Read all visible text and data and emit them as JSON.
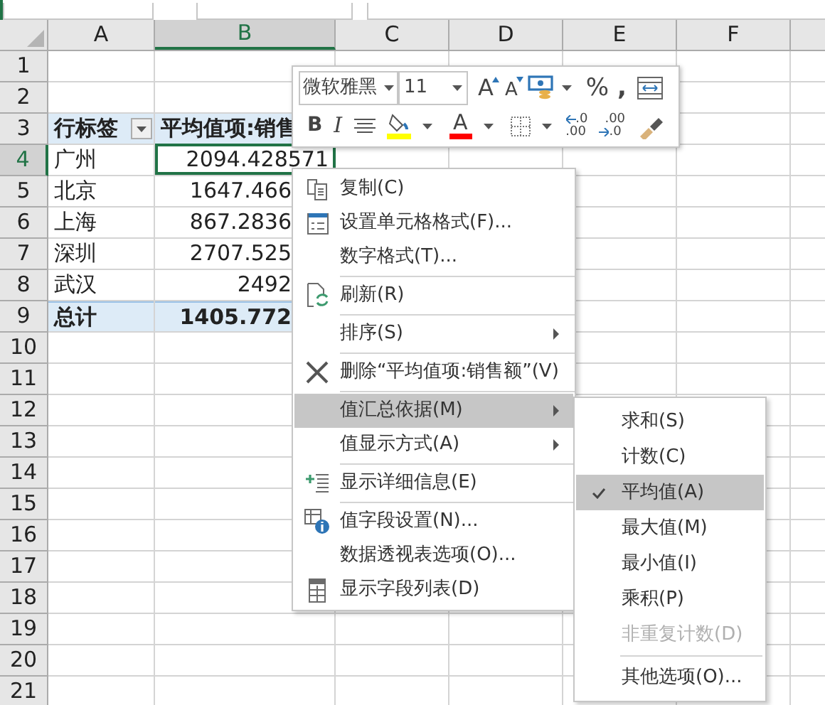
{
  "sheet": {
    "columns": [
      {
        "label": "A",
        "selected": false
      },
      {
        "label": "B",
        "selected": true
      },
      {
        "label": "C",
        "selected": false
      },
      {
        "label": "D",
        "selected": false
      },
      {
        "label": "E",
        "selected": false
      },
      {
        "label": "F",
        "selected": false
      }
    ],
    "rows": [
      {
        "label": "1",
        "selected": false,
        "kind": "blank",
        "cells": []
      },
      {
        "label": "2",
        "selected": false,
        "kind": "blank",
        "cells": []
      },
      {
        "label": "3",
        "selected": false,
        "kind": "pivot_header",
        "cells": [
          "行标签",
          "平均值项:销售"
        ]
      },
      {
        "label": "4",
        "selected": true,
        "kind": "pivot_row",
        "cells": [
          "广州",
          "2094.428571"
        ]
      },
      {
        "label": "5",
        "selected": false,
        "kind": "pivot_row",
        "cells": [
          "北京",
          "1647.466"
        ]
      },
      {
        "label": "6",
        "selected": false,
        "kind": "pivot_row",
        "cells": [
          "上海",
          "867.2836"
        ]
      },
      {
        "label": "7",
        "selected": false,
        "kind": "pivot_row",
        "cells": [
          "深圳",
          "2707.525"
        ]
      },
      {
        "label": "8",
        "selected": false,
        "kind": "pivot_row",
        "cells": [
          "武汉",
          "2492"
        ]
      },
      {
        "label": "9",
        "selected": false,
        "kind": "pivot_total",
        "cells": [
          "总计",
          "1405.772"
        ]
      },
      {
        "label": "10",
        "selected": false,
        "kind": "blank",
        "cells": []
      },
      {
        "label": "11",
        "selected": false,
        "kind": "blank",
        "cells": []
      },
      {
        "label": "12",
        "selected": false,
        "kind": "blank",
        "cells": []
      },
      {
        "label": "13",
        "selected": false,
        "kind": "blank",
        "cells": []
      },
      {
        "label": "14",
        "selected": false,
        "kind": "blank",
        "cells": []
      },
      {
        "label": "15",
        "selected": false,
        "kind": "blank",
        "cells": []
      },
      {
        "label": "16",
        "selected": false,
        "kind": "blank",
        "cells": []
      },
      {
        "label": "17",
        "selected": false,
        "kind": "blank",
        "cells": []
      },
      {
        "label": "18",
        "selected": false,
        "kind": "blank",
        "cells": []
      },
      {
        "label": "19",
        "selected": false,
        "kind": "blank",
        "cells": []
      },
      {
        "label": "20",
        "selected": false,
        "kind": "blank",
        "cells": []
      },
      {
        "label": "21",
        "selected": false,
        "kind": "blank",
        "cells": []
      }
    ]
  },
  "mini_toolbar": {
    "font": "微软雅黑",
    "size": "11",
    "grow_letter": "A",
    "shrink_letter": "A",
    "percent": "%",
    "comma": ",",
    "bold": "B",
    "italic": "I",
    "font_letter": "A",
    "increase_decimal": [
      ".0",
      ".00"
    ],
    "decrease_decimal": [
      ".00",
      ".0"
    ]
  },
  "context_menu": {
    "items": [
      {
        "kind": "item",
        "label": "复制(C)",
        "submenu": false,
        "selected": false
      },
      {
        "kind": "item",
        "label": "设置单元格格式(F)...",
        "submenu": false,
        "selected": false
      },
      {
        "kind": "item",
        "label": "数字格式(T)...",
        "submenu": false,
        "selected": false
      },
      {
        "kind": "separator"
      },
      {
        "kind": "item",
        "label": "刷新(R)",
        "submenu": false,
        "selected": false
      },
      {
        "kind": "separator"
      },
      {
        "kind": "item",
        "label": "排序(S)",
        "submenu": true,
        "selected": false
      },
      {
        "kind": "separator"
      },
      {
        "kind": "item",
        "label": "删除“平均值项:销售额”(V)",
        "submenu": false,
        "selected": false
      },
      {
        "kind": "separator"
      },
      {
        "kind": "item",
        "label": "值汇总依据(M)",
        "submenu": true,
        "selected": true
      },
      {
        "kind": "item",
        "label": "值显示方式(A)",
        "submenu": true,
        "selected": false
      },
      {
        "kind": "separator"
      },
      {
        "kind": "item",
        "label": "显示详细信息(E)",
        "submenu": false,
        "selected": false
      },
      {
        "kind": "separator"
      },
      {
        "kind": "item",
        "label": "值字段设置(N)...",
        "submenu": false,
        "selected": false
      },
      {
        "kind": "item",
        "label": "数据透视表选项(O)...",
        "submenu": false,
        "selected": false
      },
      {
        "kind": "item",
        "label": "显示字段列表(D)",
        "submenu": false,
        "selected": false
      }
    ]
  },
  "submenu": {
    "items": [
      {
        "kind": "item",
        "label": "求和(S)",
        "checked": false,
        "selected": false,
        "disabled": false
      },
      {
        "kind": "item",
        "label": "计数(C)",
        "checked": false,
        "selected": false,
        "disabled": false
      },
      {
        "kind": "item",
        "label": "平均值(A)",
        "checked": true,
        "selected": true,
        "disabled": false
      },
      {
        "kind": "item",
        "label": "最大值(M)",
        "checked": false,
        "selected": false,
        "disabled": false
      },
      {
        "kind": "item",
        "label": "最小值(I)",
        "checked": false,
        "selected": false,
        "disabled": false
      },
      {
        "kind": "item",
        "label": "乘积(P)",
        "checked": false,
        "selected": false,
        "disabled": false
      },
      {
        "kind": "item",
        "label": "非重复计数(D)",
        "checked": false,
        "selected": false,
        "disabled": true
      },
      {
        "kind": "separator"
      },
      {
        "kind": "item",
        "label": "其他选项(O)...",
        "checked": false,
        "selected": false,
        "disabled": false
      }
    ]
  }
}
